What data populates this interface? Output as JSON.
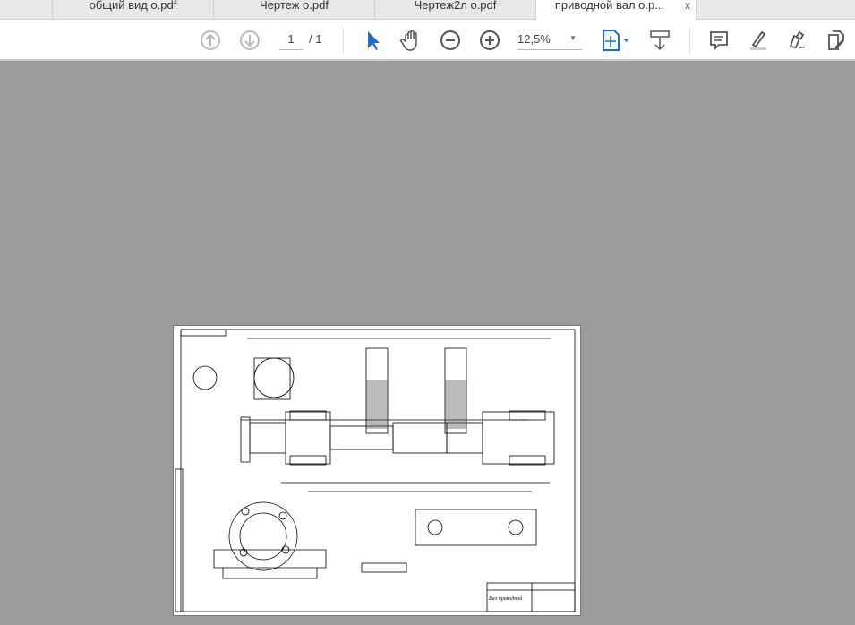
{
  "tabs": [
    {
      "label": "общий вид о.pdf",
      "active": false
    },
    {
      "label": "Чертеж о.pdf",
      "active": false
    },
    {
      "label": "Чертеж2л о.pdf",
      "active": false
    },
    {
      "label": "приводной вал о.р...",
      "active": true
    }
  ],
  "tab_close": "x",
  "toolbar": {
    "page_current": "1",
    "page_total": "/ 1",
    "zoom": "12,5%",
    "icons": [
      "arrow-up-icon",
      "arrow-down-icon",
      "select-cursor-icon",
      "hand-icon",
      "zoom-out-icon",
      "zoom-in-icon",
      "fit-page-icon",
      "scroll-mode-icon",
      "comment-icon",
      "highlight-icon",
      "sign-icon",
      "edit-pdf-icon"
    ]
  },
  "colors": {
    "accent": "#1a6fd1",
    "canvas": "#9b9b9b"
  },
  "document": {
    "title_block_name": "Вал приводной"
  }
}
